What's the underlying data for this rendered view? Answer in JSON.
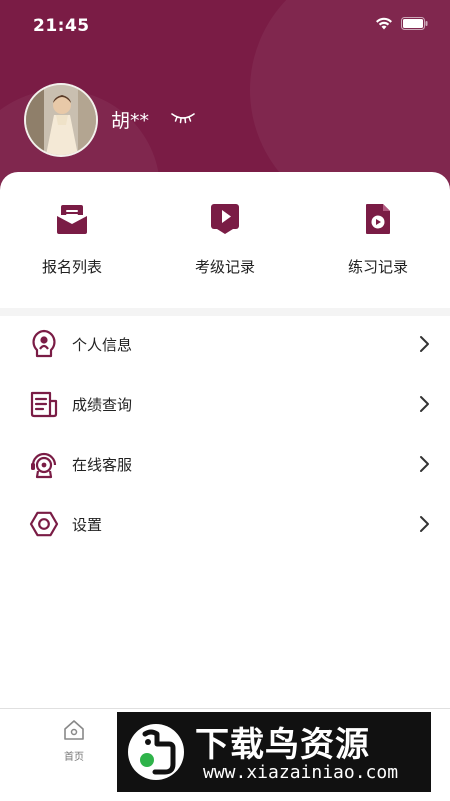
{
  "status_bar": {
    "time": "21:45"
  },
  "profile": {
    "name": "胡**"
  },
  "quick_actions": [
    {
      "label": "报名列表",
      "icon": "envelope-icon"
    },
    {
      "label": "考级记录",
      "icon": "play-ribbon-icon"
    },
    {
      "label": "练习记录",
      "icon": "video-file-icon"
    }
  ],
  "menu": [
    {
      "label": "个人信息",
      "icon": "user-info-icon"
    },
    {
      "label": "成绩查询",
      "icon": "report-icon"
    },
    {
      "label": "在线客服",
      "icon": "support-icon"
    },
    {
      "label": "设置",
      "icon": "settings-icon"
    }
  ],
  "tabbar": {
    "home_label": "首页"
  },
  "watermark": {
    "title": "下载鸟资源",
    "url": "www.xiazainiao.com"
  },
  "colors": {
    "brand": "#7a1c45",
    "background": "#ffffff"
  }
}
